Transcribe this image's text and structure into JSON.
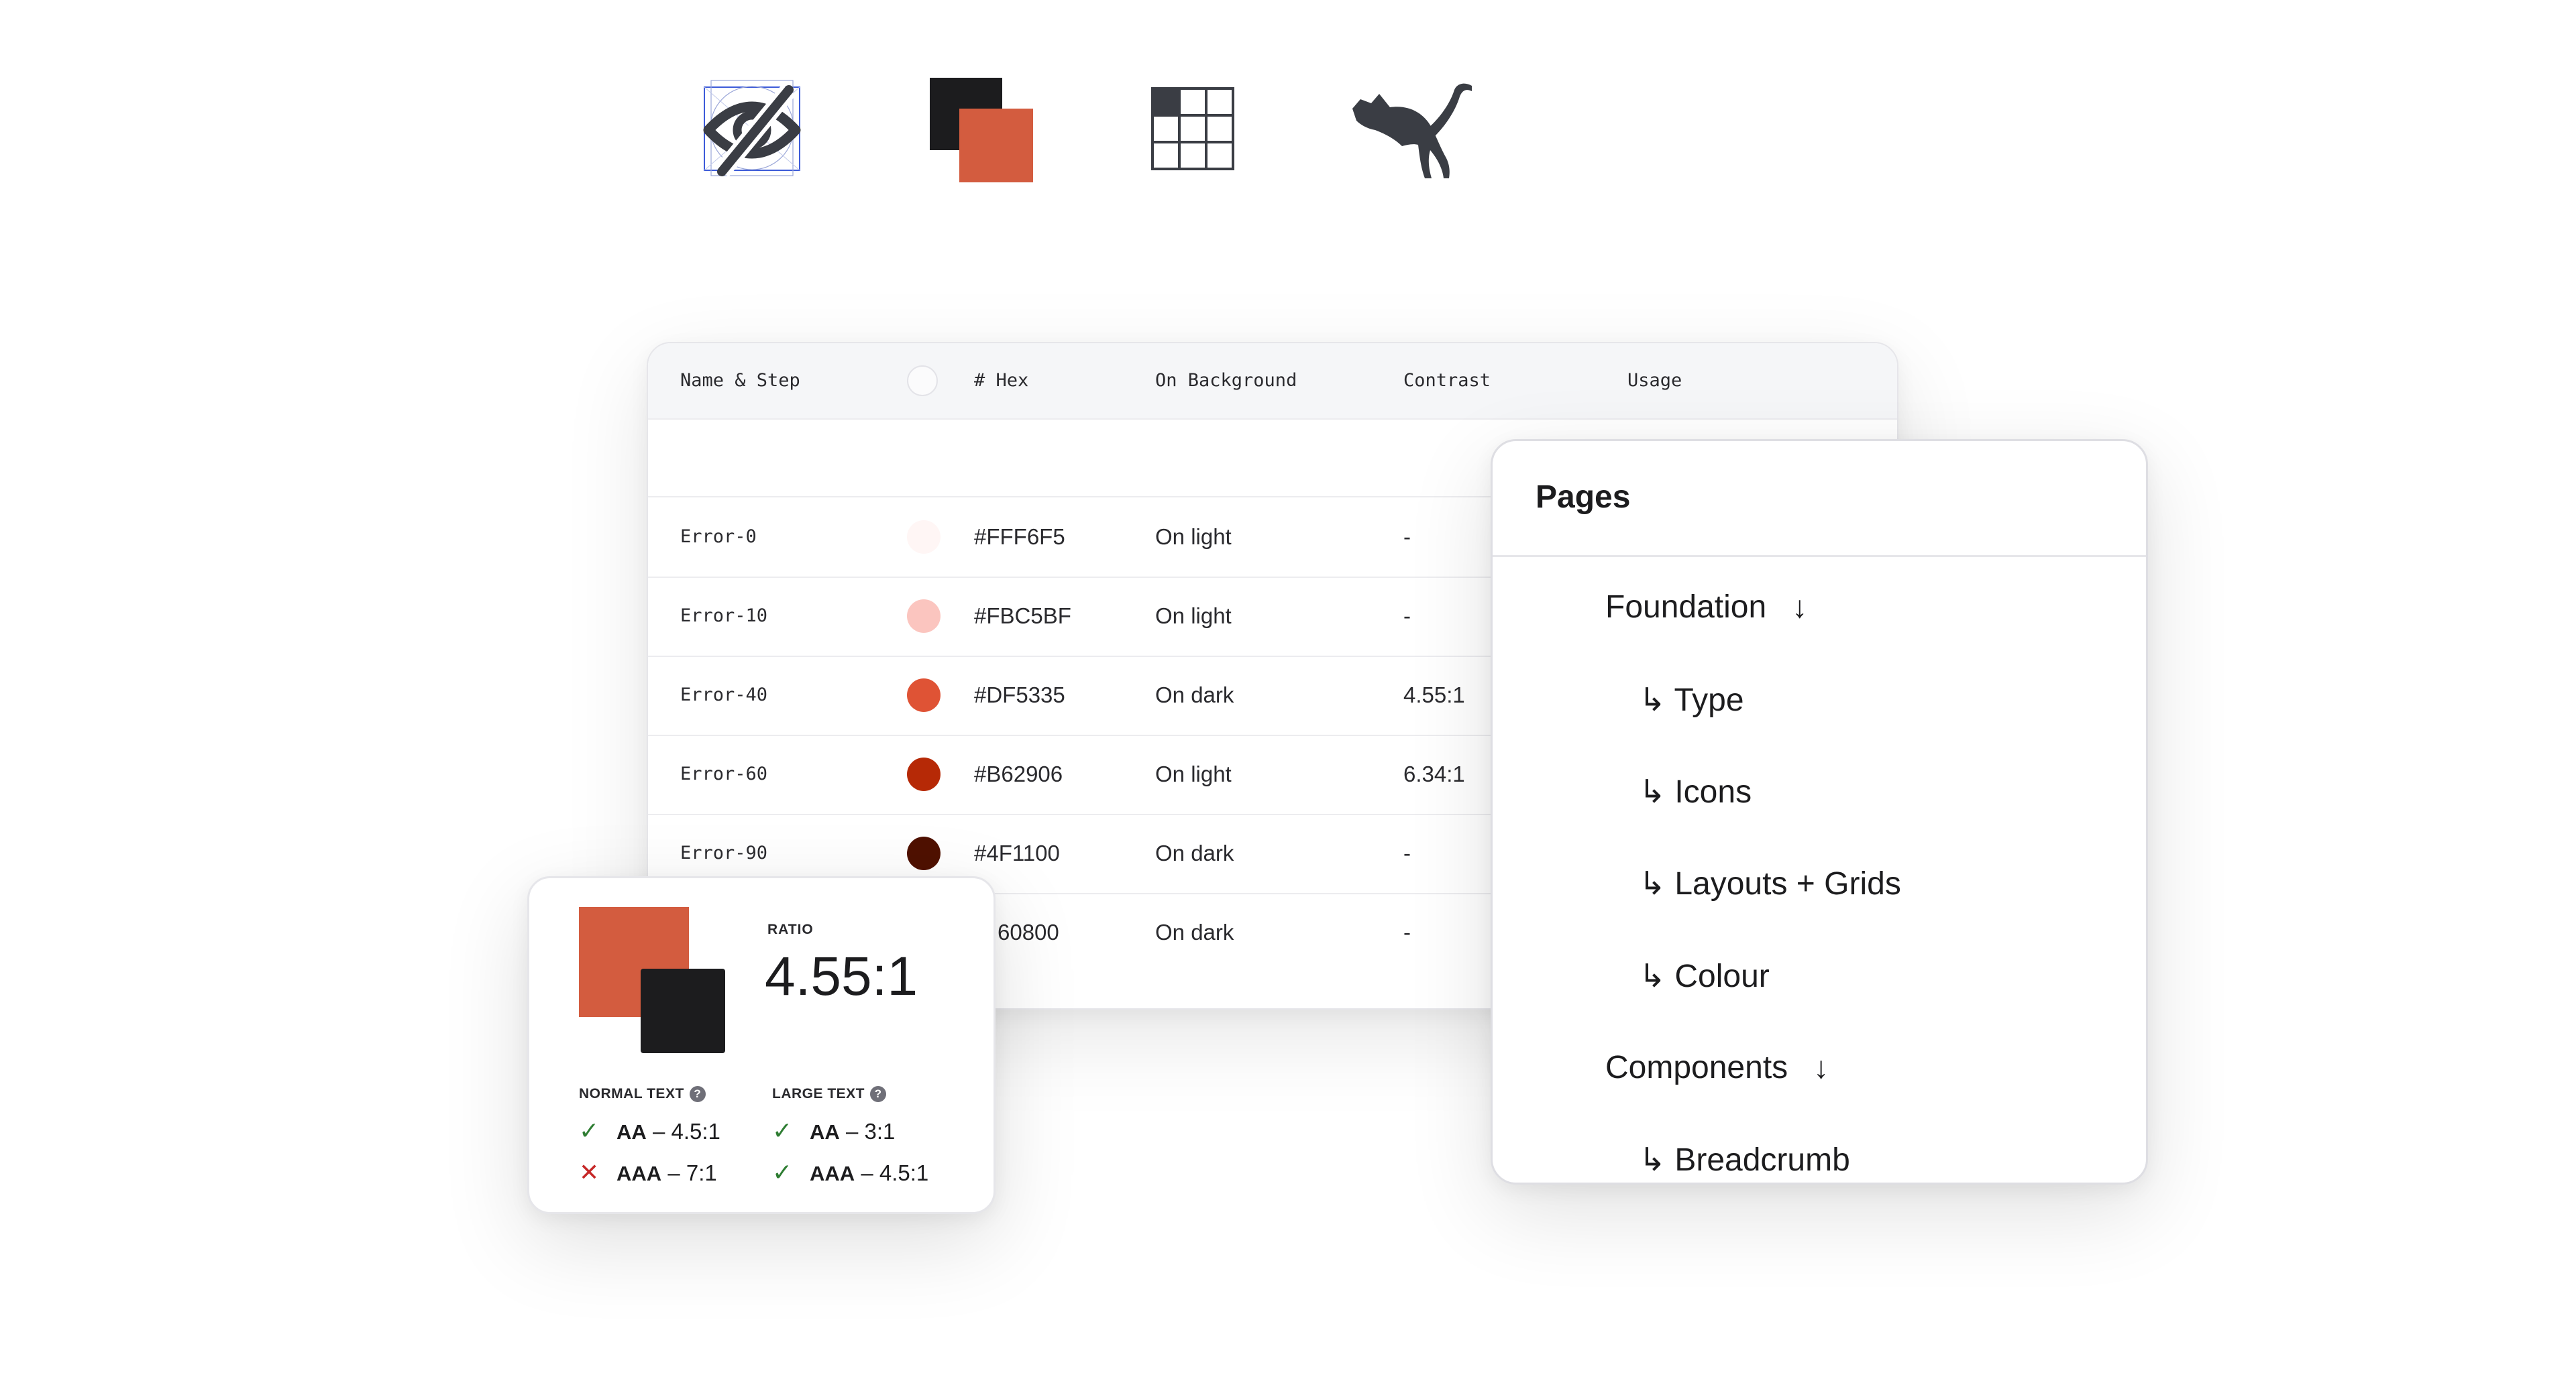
{
  "icons": [
    {
      "name": "eye-slash-icon"
    },
    {
      "name": "color-overlap-icon"
    },
    {
      "name": "grid-icon"
    },
    {
      "name": "puma-logo"
    }
  ],
  "colors": {
    "error_0": "#FFF6F5",
    "error_10": "#FBC5BF",
    "error_40": "#DF5335",
    "error_60": "#B62906",
    "error_90": "#4F1100",
    "dark": "#1C1C1E",
    "accent": "#D35C3F",
    "pass": "#2E7D32",
    "fail": "#C62828"
  },
  "table": {
    "headers": {
      "name": "Name & Step",
      "hex": "# Hex",
      "background": "On Background",
      "contrast": "Contrast",
      "usage": "Usage"
    },
    "rows": [
      {
        "name": "Error-0",
        "hex": "#FFF6F5",
        "background": "On light",
        "contrast": "-",
        "color": "#FFF6F5"
      },
      {
        "name": "Error-10",
        "hex": "#FBC5BF",
        "background": "On light",
        "contrast": "-",
        "color": "#FBC5BF"
      },
      {
        "name": "Error-40",
        "hex": "#DF5335",
        "background": "On dark",
        "contrast": "4.55:1",
        "color": "#DF5335"
      },
      {
        "name": "Error-60",
        "hex": "#B62906",
        "background": "On light",
        "contrast": "6.34:1",
        "color": "#B62906"
      },
      {
        "name": "Error-90",
        "hex": "#4F1100",
        "background": "On dark",
        "contrast": "-",
        "color": "#4F1100"
      },
      {
        "name": "",
        "hex": "60800",
        "background": "On dark",
        "contrast": "-",
        "color": ""
      }
    ]
  },
  "pages": {
    "title": "Pages",
    "sections": [
      {
        "label": "Foundation",
        "items": [
          "Type",
          "Icons",
          "Layouts + Grids",
          "Colour"
        ]
      },
      {
        "label": "Components",
        "items": [
          "Breadcrumb"
        ]
      }
    ]
  },
  "contrast_card": {
    "ratio_label": "RATIO",
    "ratio_value": "4.55:1",
    "normal_text": {
      "label": "NORMAL TEXT",
      "checks": [
        {
          "level": "AA",
          "value": "– 4.5:1",
          "pass": true
        },
        {
          "level": "AAA",
          "value": "– 7:1",
          "pass": false
        }
      ]
    },
    "large_text": {
      "label": "LARGE TEXT",
      "checks": [
        {
          "level": "AA",
          "value": "– 3:1",
          "pass": true
        },
        {
          "level": "AAA",
          "value": "– 4.5:1",
          "pass": true
        }
      ]
    }
  }
}
